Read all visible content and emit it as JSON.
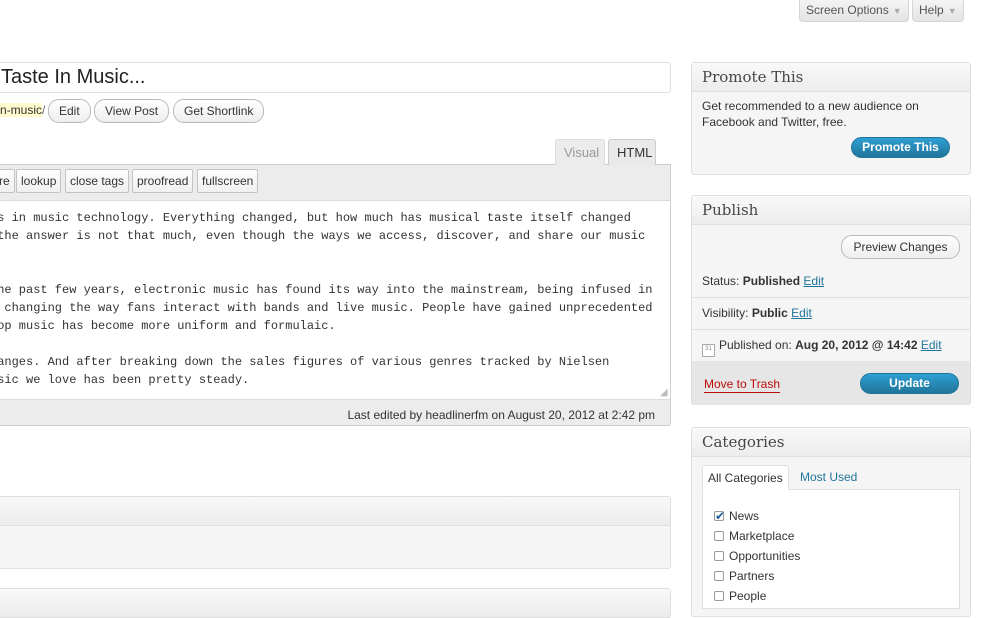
{
  "top": {
    "screen_options": "Screen Options",
    "help": "Help",
    "arrow": "▼"
  },
  "post": {
    "title": "Taste In Music...",
    "permalink_slug": "n-music",
    "permalink_slash": "/",
    "edit_btn": "Edit",
    "view_btn": "View Post",
    "shortlink_btn": "Get Shortlink"
  },
  "editor": {
    "tab_visual": "Visual",
    "tab_html": "HTML",
    "quicktags": [
      "re",
      "lookup",
      "close tags",
      "proofread",
      "fullscreen"
    ],
    "lines": [
      "is in music technology. Everything changed, but how much has musical taste itself changed",
      " the answer is not that much, even though the ways we access, discover, and share our music",
      "",
      "",
      "the past few years, electronic music has found its way into the mainstream, being infused in",
      "s changing the way fans interact with bands and live music. People have gained unprecedented",
      "pop music has become more uniform and formulaic.",
      "",
      "hanges. And after breaking down the sales figures of various genres tracked by Nielsen",
      "usic we love has been pretty steady."
    ],
    "last_edited": "Last edited by headlinerfm on August 20, 2012 at 2:42 pm"
  },
  "promote": {
    "title": "Promote This",
    "desc_line1": "Get recommended to a new audience on",
    "desc_line2": "Facebook and Twitter, free.",
    "button": "Promote This"
  },
  "publish": {
    "title": "Publish",
    "preview_btn": "Preview Changes",
    "status_label": "Status:",
    "status_value": "Published",
    "visibility_label": "Visibility:",
    "visibility_value": "Public",
    "edit_link": "Edit",
    "published_label": "Published on:",
    "published_value": "Aug 20, 2012 @ 14:42",
    "trash": "Move to Trash",
    "update": "Update"
  },
  "categories": {
    "title": "Categories",
    "tab_all": "All Categories",
    "tab_most": "Most Used",
    "items": [
      {
        "label": "News",
        "checked": true
      },
      {
        "label": "Marketplace",
        "checked": false
      },
      {
        "label": "Opportunities",
        "checked": false
      },
      {
        "label": "Partners",
        "checked": false
      },
      {
        "label": "People",
        "checked": false
      }
    ]
  },
  "colors": {
    "link": "#21759b",
    "primary": "#21759b",
    "trash": "#bc0b0b",
    "slug_highlight": "#fffbcc"
  }
}
